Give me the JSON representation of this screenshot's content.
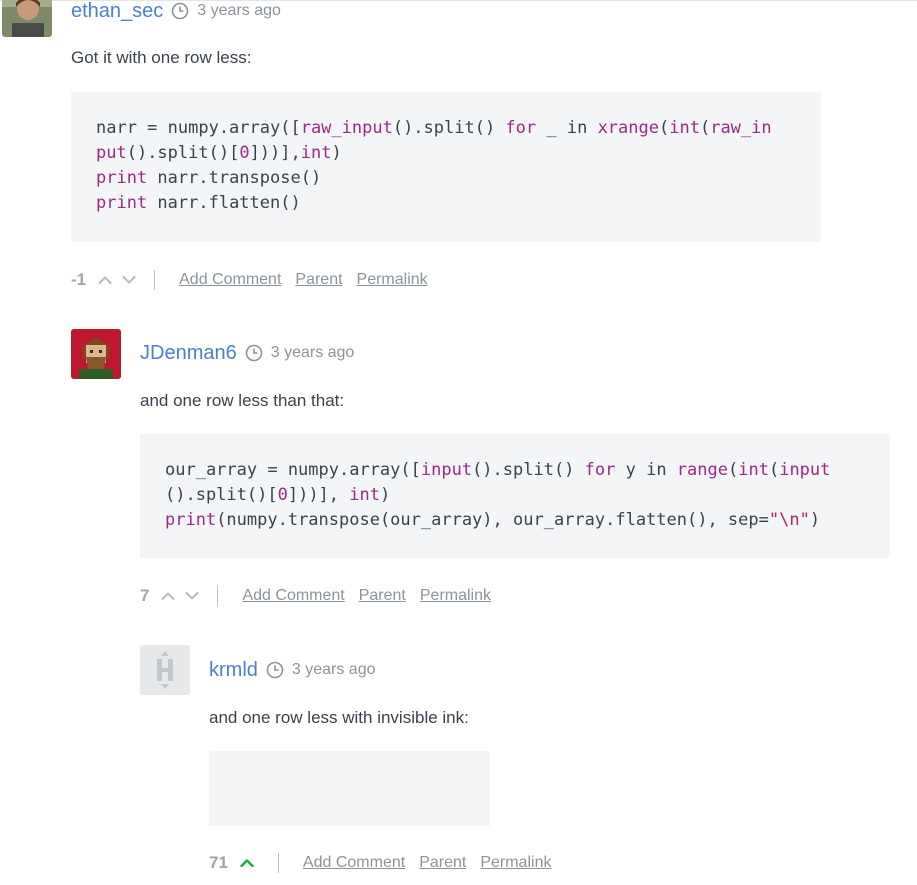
{
  "comments": [
    {
      "username": "ethan_sec",
      "time": "3 years ago",
      "text": "Got it with one row less:",
      "code": [
        [
          {
            "t": "narr = numpy.array(["
          },
          {
            "t": "raw_input",
            "k": "kw"
          },
          {
            "t": "().split() "
          },
          {
            "t": "for",
            "k": "kw"
          },
          {
            "t": " _ in "
          },
          {
            "t": "xrange",
            "k": "kw"
          },
          {
            "t": "("
          },
          {
            "t": "int",
            "k": "kw"
          },
          {
            "t": "("
          },
          {
            "t": "raw_in",
            "k": "kw"
          }
        ],
        [
          {
            "t": "put",
            "k": "kw"
          },
          {
            "t": "().split()["
          },
          {
            "t": "0",
            "k": "kw"
          },
          {
            "t": "]))],"
          },
          {
            "t": "int",
            "k": "kw"
          },
          {
            "t": ")"
          }
        ],
        [
          {
            "t": "print",
            "k": "kw"
          },
          {
            "t": " narr.transpose()"
          }
        ],
        [
          {
            "t": "print",
            "k": "kw"
          },
          {
            "t": " narr.flatten()"
          }
        ]
      ],
      "score": "-1",
      "actions": {
        "add_comment": "Add Comment",
        "parent": "Parent",
        "permalink": "Permalink"
      }
    },
    {
      "username": "JDenman6",
      "time": "3 years ago",
      "text": "and one row less than that:",
      "code": [
        [
          {
            "t": "our_array = numpy.array(["
          },
          {
            "t": "input",
            "k": "kw"
          },
          {
            "t": "().split() "
          },
          {
            "t": "for",
            "k": "kw"
          },
          {
            "t": " y in "
          },
          {
            "t": "range",
            "k": "kw"
          },
          {
            "t": "("
          },
          {
            "t": "int",
            "k": "kw"
          },
          {
            "t": "("
          },
          {
            "t": "input",
            "k": "kw"
          }
        ],
        [
          {
            "t": "().split()["
          },
          {
            "t": "0",
            "k": "kw"
          },
          {
            "t": "]))], "
          },
          {
            "t": "int",
            "k": "kw"
          },
          {
            "t": ")"
          }
        ],
        [
          {
            "t": "print",
            "k": "kw"
          },
          {
            "t": "(numpy.transpose(our_array), our_array.flatten(), sep="
          },
          {
            "t": "\"\\n\"",
            "k": "str"
          },
          {
            "t": ")"
          }
        ]
      ],
      "score": "7",
      "actions": {
        "add_comment": "Add Comment",
        "parent": "Parent",
        "permalink": "Permalink"
      }
    },
    {
      "username": "krmld",
      "time": "3 years ago",
      "text": "and one row less with invisible ink:",
      "code": [],
      "score": "71",
      "actions": {
        "add_comment": "Add Comment",
        "parent": "Parent",
        "permalink": "Permalink"
      }
    }
  ],
  "colors": {
    "username": "#4a7ed7",
    "keyword": "#9a2a87",
    "upvoted": "#1ba94c",
    "muted": "#8b939d",
    "code_bg": "#f3f5f6"
  },
  "icons": [
    "clock-icon",
    "upvote-icon",
    "downvote-icon"
  ]
}
